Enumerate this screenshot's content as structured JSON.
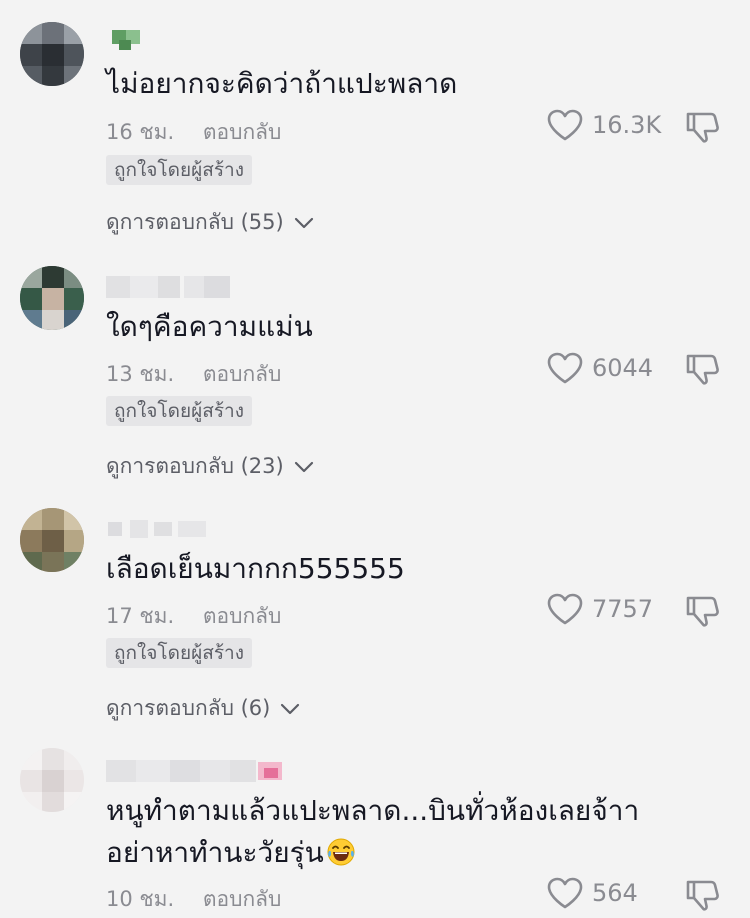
{
  "comments": [
    {
      "text": "ไม่อยากจะคิดว่าถ้าแปะพลาด",
      "time": "16 ชม.",
      "reply_label": "ตอบกลับ",
      "likes": "16.3K",
      "creator_badge": "ถูกใจโดยผู้สร้าง",
      "view_replies": "ดูการตอบกลับ (55)",
      "avatar_icon": "avatar-blurred",
      "username_icon": "username-blurred"
    },
    {
      "text": "ใดๆคือความแม่น",
      "time": "13 ชม.",
      "reply_label": "ตอบกลับ",
      "likes": "6044",
      "creator_badge": "ถูกใจโดยผู้สร้าง",
      "view_replies": "ดูการตอบกลับ (23)",
      "avatar_icon": "avatar-blurred",
      "username_icon": "username-blurred"
    },
    {
      "text": "เลือดเย็นมากกก555555",
      "time": "17 ชม.",
      "reply_label": "ตอบกลับ",
      "likes": "7757",
      "creator_badge": "ถูกใจโดยผู้สร้าง",
      "view_replies": "ดูการตอบกลับ (6)",
      "avatar_icon": "avatar-blurred",
      "username_icon": "username-blurred"
    },
    {
      "text_line1": "หนูทำตามแล้วแปะพลาด...บินทั่วห้องเลยจ้าา",
      "text_line2": "อย่าหาทำนะวัยรุ่น",
      "emoji": "laughing-tears-emoji",
      "time": "10 ชม.",
      "reply_label": "ตอบกลับ",
      "likes": "564",
      "avatar_icon": "avatar-blurred",
      "username_icon": "username-blurred"
    }
  ],
  "colors": {
    "background": "#f3f3f3",
    "text": "#161823",
    "muted": "#8a8b91",
    "badge_bg": "#e5e5e7"
  }
}
